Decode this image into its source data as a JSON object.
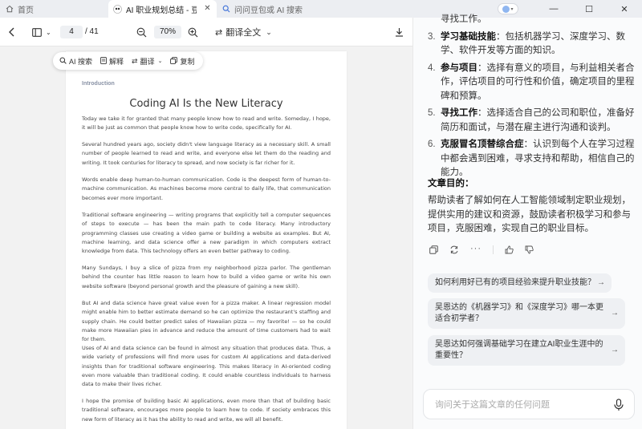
{
  "tabs": [
    {
      "title": "首页",
      "icon": "home-icon"
    },
    {
      "title": "AI 职业规划总结 - 豆包",
      "icon": "doubao-logo-icon"
    },
    {
      "title": "问问豆包或 AI 搜索",
      "icon": "search-icon"
    }
  ],
  "window_controls": {
    "minimize": "—",
    "maximize": "☐",
    "close": "✕"
  },
  "pdf_toolbar": {
    "page_current": "4",
    "page_total": "/ 41",
    "zoom": "70%",
    "translate_label": "翻译全文"
  },
  "floating_toolbar": {
    "ai_search": "AI 搜索",
    "explain": "解释",
    "translate": "翻译",
    "copy": "复制"
  },
  "document": {
    "section": "Introduction",
    "title": "Coding AI Is the New Literacy",
    "paragraphs": [
      "Today we take it for granted that many people know how to read and write. Someday, I hope, it will be just as common that people know how to write code, specifically for AI.",
      "Several hundred years ago, society didn't view language literacy as a necessary skill. A small number of people learned to read and write, and everyone else let them do the reading and writing. It took centuries for literacy to spread, and now society is far richer for it.",
      "Words enable deep human-to-human communication. Code is the deepest form of human-to-machine communication. As machines become more central to daily life, that communication becomes ever more important.",
      "Traditional software engineering — writing programs that explicitly tell a computer sequences of steps to execute — has been the main path to code literacy. Many introductory programming classes use creating a video game or building a website as examples. But AI, machine learning, and data science offer a new paradigm in which computers extract knowledge from data. This technology offers an even better pathway to coding.",
      "Many Sundays, I buy a slice of pizza from my neighborhood pizza parlor. The gentleman behind the counter has little reason to learn how to build a video game or write his own website software (beyond personal growth and the pleasure of gaining a new skill).",
      "But AI and data science have great value even for a pizza maker. A linear regression model might enable him to better estimate demand so he can optimize the restaurant's staffing and supply chain. He could better predict sales of Hawaiian pizza — my favorite! — so he could make more Hawaiian pies in advance and reduce the amount of time customers had to wait for them.",
      "Uses of AI and data science can be found in almost any situation that produces data. Thus, a wide variety of professions will find more uses for custom AI applications and data-derived insights than for traditional software engineering. This makes literacy in AI-oriented coding even more valuable than traditional coding. It could enable countless individuals to harness data to make their lives richer.",
      "I hope the promise of building basic AI applications, even more than that of building basic traditional software, encourages more people to learn how to code. If society embraces this new form of literacy as it has the ability to read and write, we will all benefit."
    ]
  },
  "side_panel": {
    "steps": [
      {
        "num": "",
        "label": "",
        "text": "寻找工作。"
      },
      {
        "num": "3.",
        "label": "学习基础技能",
        "text": "：包括机器学习、深度学习、数学、软件开发等方面的知识。"
      },
      {
        "num": "4.",
        "label": "参与项目",
        "text": "：选择有意义的项目，与利益相关者合作，评估项目的可行性和价值，确定项目的里程碑和预算。"
      },
      {
        "num": "5.",
        "label": "寻找工作",
        "text": "：选择适合自己的公司和职位，准备好简历和面试，与潜在雇主进行沟通和谈判。"
      },
      {
        "num": "6.",
        "label": "克服冒名顶替综合症",
        "text": "：认识到每个人在学习过程中都会遇到困难，寻求支持和帮助，相信自己的能力。"
      }
    ],
    "goal_heading": "文章目的：",
    "goal_text": "帮助读者了解如何在人工智能领域制定职业规划，提供实用的建议和资源，鼓励读者积极学习和参与项目，克服困难，实现自己的职业目标。",
    "suggestions": [
      "如何利用好已有的项目经验来提升职业技能？",
      "吴恩达的《机器学习》和《深度学习》哪一本更适合初学者？",
      "吴恩达如何强调基础学习在建立AI职业生涯中的重要性？"
    ],
    "chat_placeholder": "询问关于这篇文章的任何问题"
  },
  "colors": {
    "accent_blue": "#3b6fd8",
    "tab_bar": "#eceef2",
    "panel_bg": "#fafbfc",
    "suggestion_bg": "#eef0f3"
  }
}
